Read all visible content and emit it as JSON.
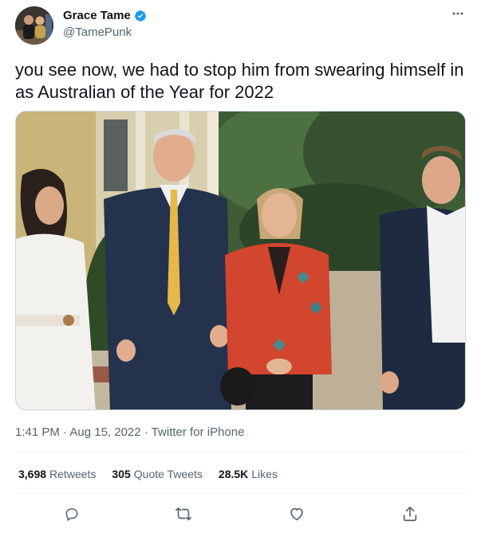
{
  "author": {
    "display_name": "Grace Tame",
    "handle": "@TamePunk",
    "verified": true
  },
  "tweet": {
    "text": "you see now, we had to stop him from swearing himself in as Australian of the Year for 2022",
    "time": "1:41 PM",
    "date": "Aug 15, 2022",
    "source": "Twitter for iPhone"
  },
  "stats": {
    "retweets_count": "3,698",
    "retweets_label": "Retweets",
    "quotes_count": "305",
    "quotes_label": "Quote Tweets",
    "likes_count": "28.5K",
    "likes_label": "Likes"
  },
  "icons": {
    "more": "more-icon",
    "reply": "reply-icon",
    "retweet": "retweet-icon",
    "like": "like-icon",
    "share": "share-icon",
    "verified": "verified-badge-icon"
  },
  "colors": {
    "text": "#0f1419",
    "secondary": "#536471",
    "verified": "#1d9bf0",
    "divider": "#eff3f4"
  }
}
